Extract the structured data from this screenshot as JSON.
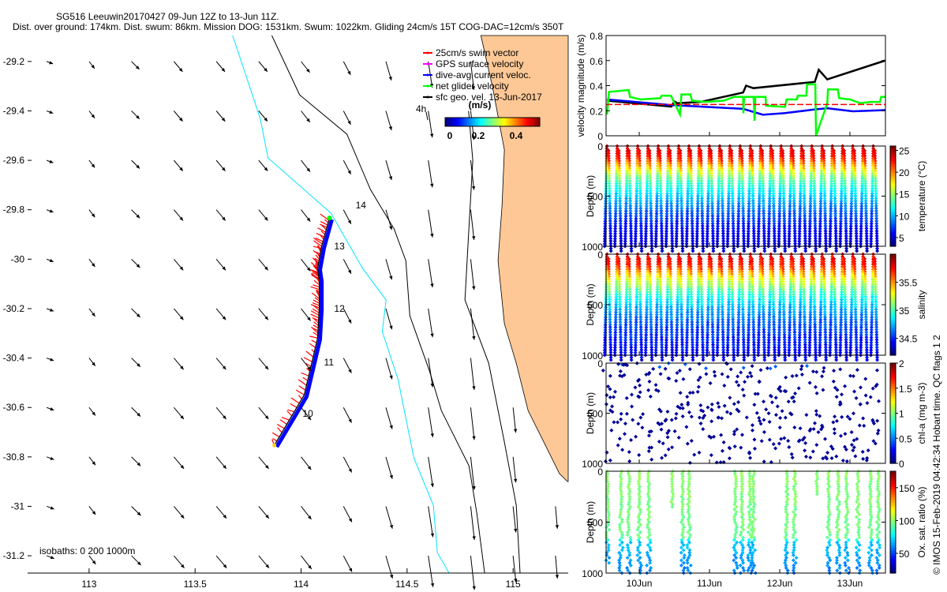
{
  "title": {
    "line1": "SG516 Leeuwin20170427 09-Jun 12Z to 13-Jun 11Z.",
    "line2": "Dist. over ground: 174km. Dist. swum: 86km. Mission DOG: 1531km. Swum: 1022km. Gliding 24cm/s 15T COG-DAC=12cm/s 350T"
  },
  "footer": "© IMOS 15-Feb-2019 04:42:34 Hobart time. QC flags 1  2",
  "chart_data": [
    {
      "type": "map-quiver",
      "xlim": [
        112.71,
        115.26
      ],
      "ylim": [
        -31.27,
        -29.095
      ],
      "xticks": [
        113,
        113.5,
        114,
        114.5,
        115
      ],
      "xtick_labels": [
        "113",
        "113.5",
        "114",
        "114.5",
        "115"
      ],
      "yticks": [
        -29.2,
        -29.4,
        -29.6,
        -29.8,
        -30,
        -30.2,
        -30.4,
        -30.6,
        -30.8,
        -31,
        -31.2
      ],
      "ytick_labels": [
        "-29.2",
        "-29.4",
        "-29.6",
        "-29.8",
        "-30",
        "-30.2",
        "-30.4",
        "-30.6",
        "-30.8",
        "-31",
        "-31.2"
      ],
      "legend": [
        {
          "label": "25cm/s swim vector",
          "color": "#ff0000"
        },
        {
          "label": "GPS surface velocity",
          "color": "#ff00ff"
        },
        {
          "label": "dive-avg current veloc.",
          "color": "#0000ff"
        },
        {
          "label": "net glider velocity",
          "color": "#00ff00"
        },
        {
          "label": "sfc geo. vel. 13-Jun-2017",
          "color": "#000000"
        }
      ],
      "legend_placement": "top-right",
      "vector_scale_label": "4h",
      "colorbar": {
        "units": "(m/s)",
        "range": [
          0,
          0.5
        ],
        "ticks": [
          0,
          0.2,
          0.4
        ],
        "tick_labels": [
          "0",
          "0.2",
          "0.4"
        ],
        "colormap": "jet"
      },
      "isobath_label": "isobaths: 0  200  1000m",
      "land_color": "#fdc895",
      "isobath_200_color": "#00e5ff",
      "isobath_1000_color": "#000000",
      "coastline": [
        [
          114.848,
          -29.095
        ],
        [
          114.903,
          -29.303
        ],
        [
          114.959,
          -29.558
        ],
        [
          114.948,
          -29.782
        ],
        [
          114.929,
          -30.006
        ],
        [
          114.959,
          -30.261
        ],
        [
          115.015,
          -30.421
        ],
        [
          115.071,
          -30.613
        ],
        [
          115.145,
          -30.74
        ],
        [
          115.219,
          -30.868
        ],
        [
          115.257,
          -30.9
        ]
      ],
      "isobath_200": [
        [
          113.677,
          -29.095
        ],
        [
          113.807,
          -29.43
        ],
        [
          113.844,
          -29.59
        ],
        [
          114.141,
          -29.814
        ],
        [
          114.29,
          -30.037
        ],
        [
          114.401,
          -30.165
        ],
        [
          114.383,
          -30.293
        ],
        [
          114.457,
          -30.485
        ],
        [
          114.532,
          -30.804
        ],
        [
          114.624,
          -30.996
        ],
        [
          114.643,
          -31.188
        ],
        [
          114.699,
          -31.271
        ]
      ],
      "isobath_1000": [
        [
          113.862,
          -29.095
        ],
        [
          113.993,
          -29.335
        ],
        [
          114.216,
          -29.494
        ],
        [
          114.327,
          -29.718
        ],
        [
          114.439,
          -29.878
        ],
        [
          114.494,
          -30.006
        ],
        [
          114.513,
          -30.229
        ],
        [
          114.606,
          -30.453
        ],
        [
          114.662,
          -30.613
        ],
        [
          114.792,
          -30.836
        ],
        [
          114.829,
          -31.028
        ],
        [
          114.866,
          -31.271
        ]
      ],
      "isobath_1000_inner": [
        [
          114.79,
          -29.4
        ],
        [
          114.81,
          -29.6
        ],
        [
          114.79,
          -29.9
        ],
        [
          114.773,
          -30.165
        ],
        [
          114.885,
          -30.421
        ],
        [
          114.959,
          -30.74
        ],
        [
          115.015,
          -30.996
        ],
        [
          115.033,
          -31.271
        ]
      ],
      "current_field": {
        "lons": [
          112.8,
          113.0,
          113.2,
          113.4,
          113.6,
          113.8,
          114.0,
          114.2,
          114.4,
          114.6,
          114.8,
          115.0,
          115.2
        ],
        "lats": [
          -29.2,
          -29.4,
          -29.6,
          -29.8,
          -30.0,
          -30.2,
          -30.4,
          -30.6,
          -30.8,
          -31.0,
          -31.2
        ],
        "u": [
          0.08,
          0.07,
          0.1,
          0.11,
          0.11,
          0.11,
          0.11,
          0.09,
          0.07,
          0.05,
          0.04,
          0.03,
          0.02
        ],
        "v": [
          -0.03,
          -0.09,
          -0.1,
          -0.13,
          -0.13,
          -0.13,
          -0.14,
          -0.17,
          -0.24,
          -0.33,
          -0.36,
          -0.28,
          -0.24
        ]
      },
      "track": [
        [
          113.874,
          -30.753
        ],
        [
          114.015,
          -30.549
        ],
        [
          114.078,
          -30.319
        ],
        [
          114.086,
          -30.197
        ],
        [
          114.086,
          -30.085
        ],
        [
          114.078,
          -30.037
        ],
        [
          114.097,
          -29.948
        ],
        [
          114.134,
          -29.833
        ]
      ],
      "day_labels": [
        {
          "label": "10",
          "lon": 114.007,
          "lat": -30.638
        },
        {
          "label": "11",
          "lon": 114.108,
          "lat": -30.43
        },
        {
          "label": "12",
          "lon": 114.156,
          "lat": -30.213
        },
        {
          "label": "13",
          "lon": 114.156,
          "lat": -29.961
        },
        {
          "label": "14",
          "lon": 114.257,
          "lat": -29.795
        }
      ]
    },
    {
      "type": "line",
      "ylabel": "velocity magnitude (m/s)",
      "xlim": [
        "2017-06-09 12:40",
        "2017-06-13 12:08"
      ],
      "ylim": [
        0,
        0.8
      ],
      "yticks": [
        0,
        0.2,
        0.4,
        0.6,
        0.8
      ],
      "ytick_labels": [
        "0",
        "0.2",
        "0.4",
        "0.6",
        "0.8"
      ],
      "series": [
        {
          "color": "#000000",
          "points": [
            [
              "2017-06-09 13:00",
              0.28
            ],
            [
              "2017-06-10 11:00",
              0.233
            ],
            [
              "2017-06-10 12:00",
              0.275
            ],
            [
              "2017-06-10 13:00",
              0.26
            ],
            [
              "2017-06-10 21:00",
              0.27
            ],
            [
              "2017-06-11 11:30",
              0.345
            ],
            [
              "2017-06-11 12:30",
              0.4
            ],
            [
              "2017-06-11 15:00",
              0.38
            ],
            [
              "2017-06-12 12:00",
              0.43
            ],
            [
              "2017-06-12 13:20",
              0.527
            ],
            [
              "2017-06-12 16:15",
              0.45
            ],
            [
              "2017-06-13 12:00",
              0.6
            ]
          ]
        },
        {
          "color": "#0000ff",
          "points": [
            [
              "2017-06-09 13:00",
              0.29
            ],
            [
              "2017-06-10 11:00",
              0.245
            ],
            [
              "2017-06-11 11:30",
              0.215
            ],
            [
              "2017-06-11 18:15",
              0.168
            ],
            [
              "2017-06-12 01:30",
              0.18
            ],
            [
              "2017-06-12 12:00",
              0.21
            ],
            [
              "2017-06-12 16:15",
              0.22
            ],
            [
              "2017-06-13 01:00",
              0.195
            ],
            [
              "2017-06-13 12:00",
              0.205
            ]
          ]
        },
        {
          "color": "#00ff00",
          "points": [
            [
              "2017-06-09 13:00",
              0.17
            ],
            [
              "2017-06-09 13:40",
              0.35
            ],
            [
              "2017-06-09 20:25",
              0.365
            ],
            [
              "2017-06-09 20:50",
              0.31
            ],
            [
              "2017-06-10 00:30",
              0.29
            ],
            [
              "2017-06-10 07:10",
              0.3
            ],
            [
              "2017-06-10 07:40",
              0.32
            ],
            [
              "2017-06-10 10:50",
              0.32
            ],
            [
              "2017-06-10 13:55",
              0.17
            ],
            [
              "2017-06-10 14:25",
              0.33
            ],
            [
              "2017-06-10 17:30",
              0.33
            ],
            [
              "2017-06-10 18:00",
              0.28
            ],
            [
              "2017-06-10 22:30",
              0.27
            ],
            [
              "2017-06-11 04:50",
              0.28
            ],
            [
              "2017-06-11 08:25",
              0.31
            ],
            [
              "2017-06-11 11:30",
              0.31
            ],
            [
              "2017-06-11 11:35",
              0.18
            ],
            [
              "2017-06-11 11:50",
              0.31
            ],
            [
              "2017-06-11 15:05",
              0.31
            ],
            [
              "2017-06-11 15:25",
              0.12
            ],
            [
              "2017-06-11 15:40",
              0.31
            ],
            [
              "2017-06-11 19:10",
              0.31
            ],
            [
              "2017-06-11 19:20",
              0.24
            ],
            [
              "2017-06-12 01:50",
              0.23
            ],
            [
              "2017-06-12 02:20",
              0.29
            ],
            [
              "2017-06-12 05:55",
              0.29
            ],
            [
              "2017-06-12 06:10",
              0.32
            ],
            [
              "2017-06-12 09:05",
              0.32
            ],
            [
              "2017-06-12 09:20",
              0.41
            ],
            [
              "2017-06-12 12:10",
              0.41
            ],
            [
              "2017-06-12 12:25",
              0.0
            ],
            [
              "2017-06-12 16:15",
              0.26
            ],
            [
              "2017-06-12 16:30",
              0.37
            ],
            [
              "2017-06-12 19:50",
              0.37
            ],
            [
              "2017-06-12 20:20",
              0.3
            ],
            [
              "2017-06-13 00:00",
              0.29
            ],
            [
              "2017-06-13 03:30",
              0.26
            ],
            [
              "2017-06-13 07:00",
              0.27
            ],
            [
              "2017-06-13 10:15",
              0.27
            ],
            [
              "2017-06-13 10:40",
              0.31
            ],
            [
              "2017-06-13 12:00",
              0.31
            ]
          ]
        },
        {
          "color": "#ff0000",
          "dashed": true,
          "points": [
            [
              "2017-06-09 12:40",
              0.25
            ],
            [
              "2017-06-13 12:08",
              0.25
            ]
          ]
        }
      ]
    },
    {
      "type": "scatter",
      "variable": "temperature",
      "ylabel": "Depth (m)",
      "colorbar_label": "temperature (°C)",
      "ylim": [
        1000,
        0
      ],
      "yticks": [
        0,
        500,
        1000
      ],
      "ytick_labels": [
        "0",
        "500",
        "1000"
      ],
      "crange": [
        3,
        26
      ],
      "cticks": [
        5,
        10,
        15,
        20,
        25
      ],
      "ctick_labels": [
        "5",
        "10",
        "15",
        "20",
        "25"
      ],
      "first_dive": "2017-06-09 13:15",
      "dive_interval_hours": 3.5,
      "dive_count": 27,
      "profile": [
        [
          0,
          24
        ],
        [
          100,
          22.5
        ],
        [
          200,
          18
        ],
        [
          300,
          14
        ],
        [
          450,
          11
        ],
        [
          600,
          8.5
        ],
        [
          800,
          6
        ],
        [
          1000,
          4.5
        ]
      ]
    },
    {
      "type": "scatter",
      "variable": "salinity",
      "ylabel": "Depth (m)",
      "colorbar_label": "salinity",
      "ylim": [
        1000,
        0
      ],
      "yticks": [
        0,
        500,
        1000
      ],
      "ytick_labels": [
        "0",
        "500",
        "1000"
      ],
      "crange": [
        34.2,
        36.0
      ],
      "cticks": [
        34.5,
        35,
        35.5
      ],
      "ctick_labels": [
        "34.5",
        "35",
        "35.5"
      ],
      "first_dive": "2017-06-09 13:15",
      "dive_interval_hours": 3.5,
      "dive_count": 27,
      "profile": [
        [
          0,
          35.8
        ],
        [
          100,
          35.7
        ],
        [
          200,
          35.35
        ],
        [
          350,
          35.0
        ],
        [
          500,
          34.75
        ],
        [
          700,
          34.55
        ],
        [
          1000,
          34.4
        ]
      ]
    },
    {
      "type": "scatter",
      "variable": "chl-a",
      "ylabel": "Depth (m)",
      "colorbar_label": "chl-a (mg m-3)",
      "ylim": [
        1000,
        0
      ],
      "yticks": [
        0,
        500,
        1000
      ],
      "ytick_labels": [
        "0",
        "500",
        "1000"
      ],
      "crange": [
        0,
        2
      ],
      "cticks": [
        0,
        0.5,
        1,
        1.5,
        2
      ],
      "ctick_labels": [
        "0",
        "0.5",
        "1",
        "1.5",
        "2"
      ],
      "first_dive": "2017-06-09 13:15",
      "dive_interval_hours": 3.5,
      "dive_count": 27,
      "typical_value": 0.05,
      "surface_value": 0.45
    },
    {
      "type": "scatter",
      "variable": "oxygen",
      "ylabel": "Depth (m)",
      "colorbar_label": "Ox. sat. ratio (%)",
      "ylim": [
        1000,
        0
      ],
      "yticks": [
        0,
        500,
        1000
      ],
      "ytick_labels": [
        "0",
        "500",
        "1000"
      ],
      "crange": [
        20,
        175
      ],
      "cticks": [
        50,
        100,
        150
      ],
      "ctick_labels": [
        "50",
        "100",
        "150"
      ],
      "xticks": [
        "2017-06-10 00:00",
        "2017-06-11 00:00",
        "2017-06-12 00:00",
        "2017-06-13 00:00"
      ],
      "xtick_labels": [
        "10Jun",
        "11Jun",
        "12Jun",
        "13Jun"
      ],
      "profile": [
        [
          0,
          100
        ],
        [
          650,
          95
        ],
        [
          700,
          70
        ],
        [
          1000,
          58
        ]
      ],
      "casts": [
        [
          "2017-06-09 13:13",
          900
        ],
        [
          "2017-06-09 17:49",
          1000
        ],
        [
          "2017-06-09 20:30",
          1000
        ],
        [
          "2017-06-10 00:00",
          1000
        ],
        [
          "2017-06-10 03:14",
          1000
        ],
        [
          "2017-06-10 11:20",
          350
        ],
        [
          "2017-06-10 14:50",
          1000
        ],
        [
          "2017-06-10 17:00",
          1000
        ],
        [
          "2017-06-11 08:54",
          1000
        ],
        [
          "2017-06-11 11:04",
          1000
        ],
        [
          "2017-06-11 13:45",
          1000
        ],
        [
          "2017-06-11 15:06",
          1000
        ],
        [
          "2017-06-12 02:25",
          1000
        ],
        [
          "2017-06-12 05:07",
          1000
        ],
        [
          "2017-06-12 12:40",
          230
        ],
        [
          "2017-06-12 16:43",
          1000
        ],
        [
          "2017-06-12 19:57",
          1000
        ],
        [
          "2017-06-12 22:55",
          1000
        ],
        [
          "2017-06-13 02:41",
          1000
        ],
        [
          "2017-06-13 07:00",
          1000
        ],
        [
          "2017-06-13 09:42",
          1000
        ]
      ]
    }
  ]
}
